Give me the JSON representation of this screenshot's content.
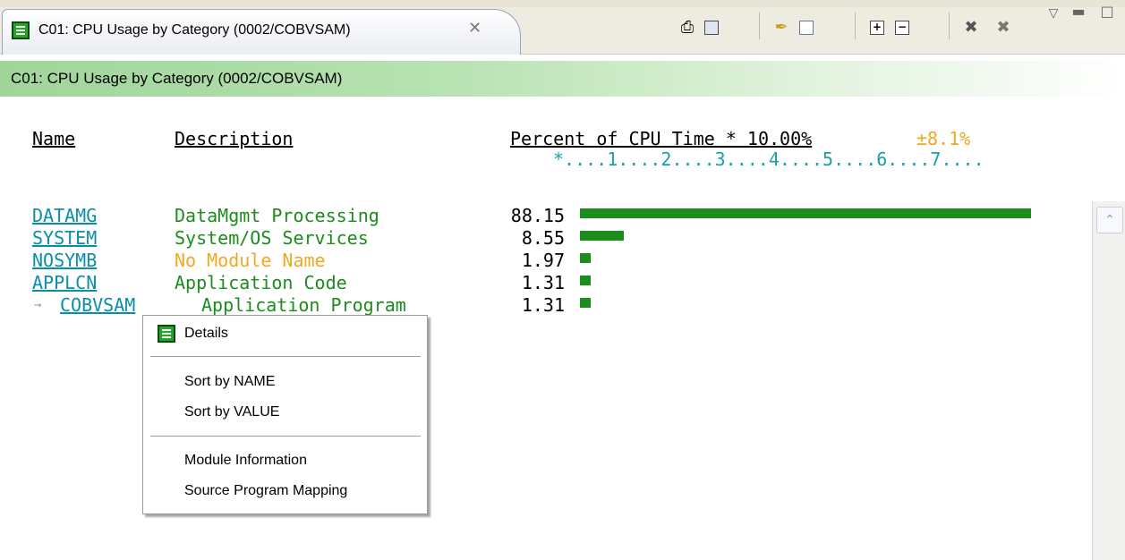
{
  "tab": {
    "title": "C01:  CPU Usage by Category (0002/COBVSAM)",
    "close_glyph": "✕"
  },
  "toolbar": {
    "icons": [
      "print-icon",
      "save-icon",
      "pin-icon",
      "copy-icon",
      "expand-icon",
      "collapse-icon",
      "delete-icon",
      "delete-all-icon",
      "view-menu-icon",
      "minimize-icon",
      "maximize-icon"
    ]
  },
  "view": {
    "header": "C01:  CPU Usage by Category (0002/COBVSAM)"
  },
  "report": {
    "columns": {
      "name": "Name",
      "description": "Description",
      "percent": "Percent of CPU Time * 10.00%",
      "tolerance": "±8.1%"
    },
    "scale": "*....1....2....3....4....5....6....7....",
    "rows": [
      {
        "name": "DATAMG",
        "description": "DataMgmt Processing",
        "percent": "88.15",
        "value": 88.15,
        "color": "#1c8c1c"
      },
      {
        "name": "SYSTEM",
        "description": "System/OS Services",
        "percent": "8.55",
        "value": 8.55,
        "color": "#1c8c1c"
      },
      {
        "name": "NOSYMB",
        "description": "No Module Name",
        "percent": "1.97",
        "value": 1.97,
        "color": "#f0a820"
      },
      {
        "name": "APPLCN",
        "description": "Application Code",
        "percent": "1.31",
        "value": 1.31,
        "color": "#1c8c1c"
      },
      {
        "name": "COBVSAM",
        "description": "Application Program",
        "percent": "1.31",
        "value": 1.31,
        "color": "#1c8c1c",
        "prefix": "→"
      }
    ]
  },
  "context_menu": {
    "details": "Details",
    "sort_name": "Sort by NAME",
    "sort_value": "Sort by VALUE",
    "module_info": "Module Information",
    "source_mapping": "Source Program Mapping"
  }
}
